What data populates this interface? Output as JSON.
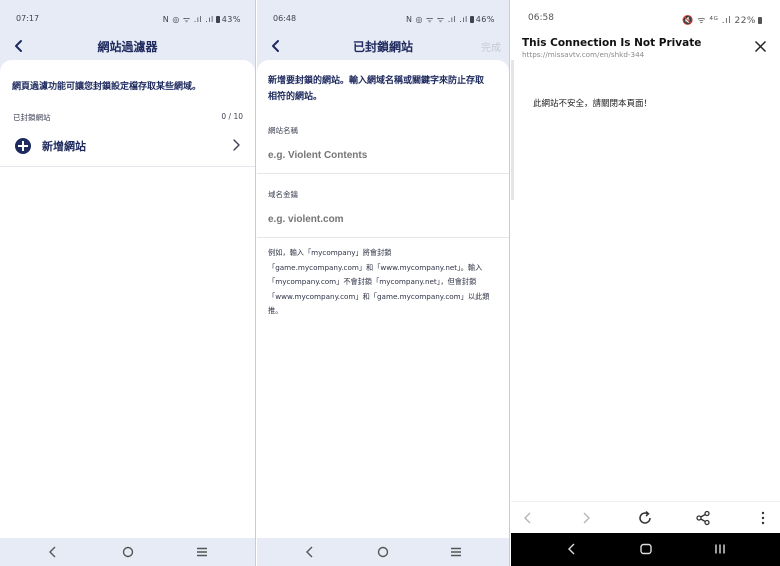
{
  "panel1": {
    "status": {
      "time": "07:17",
      "icons": "N ◎ ᯤ .ıl .ıl",
      "battery": "43%"
    },
    "header": {
      "title": "網站過濾器"
    },
    "description": "網頁過濾功能可讓您封鎖設定檔存取某些網域。",
    "section_label": "已封鎖網站",
    "count": "0 / 10",
    "add_label": "新增網站"
  },
  "panel2": {
    "status": {
      "time": "06:48",
      "icons": "N ◎ ᯤ ᯤ .ıl .ıl",
      "battery": "46%"
    },
    "header": {
      "title": "已封鎖網站",
      "done_label": "完成"
    },
    "description_line1": "新增要封鎖的網站。輸入網域名稱或關鍵字來防止存取",
    "description_line2": "相符的網站。",
    "site_name_label": "網站名稱",
    "site_name_placeholder": "e.g. Violent Contents",
    "domain_label": "域名金鑰",
    "domain_placeholder": "e.g. violent.com",
    "example_lines": [
      "例如，輸入「mycompany」將會封鎖",
      "「game.mycompany.com」和「www.mycompany.net」。輸入",
      "「mycompany.com」不會封鎖「mycompany.net」，但會封鎖",
      "「www.mycompany.com」和「game.mycompany.com」以此類",
      "推。"
    ]
  },
  "panel3": {
    "status": {
      "time": "06:58",
      "icons": "🔇 ᯤ ⁴ᴳ .ıl",
      "battery": "22%"
    },
    "page_title": "This Connection Is Not Private",
    "url": "https://missavtv.com/en/shkd-344",
    "message": "此網站不安全，請關閉本頁面！"
  },
  "colors": {
    "brand_navy": "#1e2a5e",
    "app_background": "#e7ebf5",
    "done_disabled": "#c6c9d4"
  }
}
